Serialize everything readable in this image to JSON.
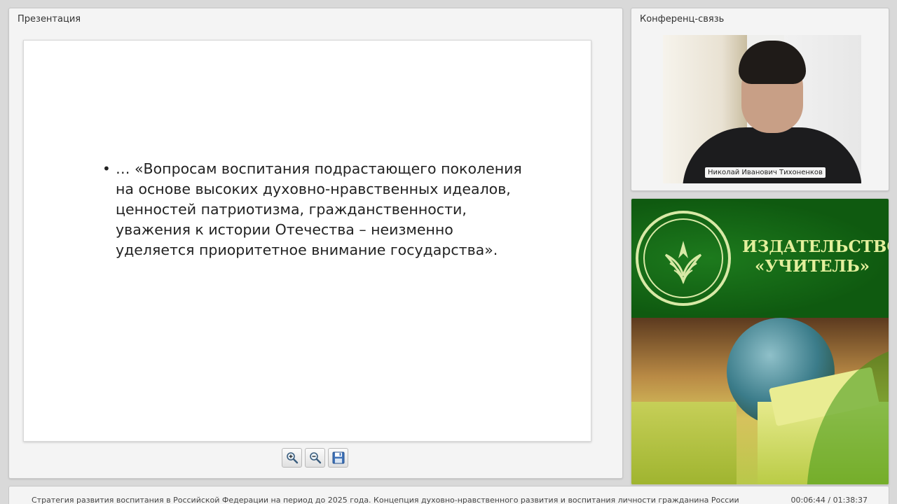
{
  "presentation": {
    "title": "Презентация",
    "slide": {
      "bullet": "•",
      "text": "… «Вопросам воспитания подрастающего поколения на основе высоких духовно-нравственных идеалов, ценностей патриотизма, гражданственности, уважения к истории Отечества – неизменно уделяется приоритетное внимание государства»."
    },
    "toolbar": {
      "zoom_in_icon": "zoom-in-icon",
      "zoom_out_icon": "zoom-out-icon",
      "save_icon": "save-icon"
    }
  },
  "conference": {
    "title": "Конференц-связь",
    "speaker_name": "Николай Иванович Тихоненков"
  },
  "publisher": {
    "line1": "ИЗДАТЕЛЬСТВО",
    "line2": "«УЧИТЕЛЬ»",
    "colors": {
      "green": "#0f5a10",
      "text": "#e3ef9c"
    }
  },
  "footer": {
    "title": "Стратегия развития воспитания в Российской Федерации на период до 2025 года. Концепция духовно-нравственного развития и воспитания личности гражданина России",
    "time": "00:06:44 / 01:38:37"
  }
}
